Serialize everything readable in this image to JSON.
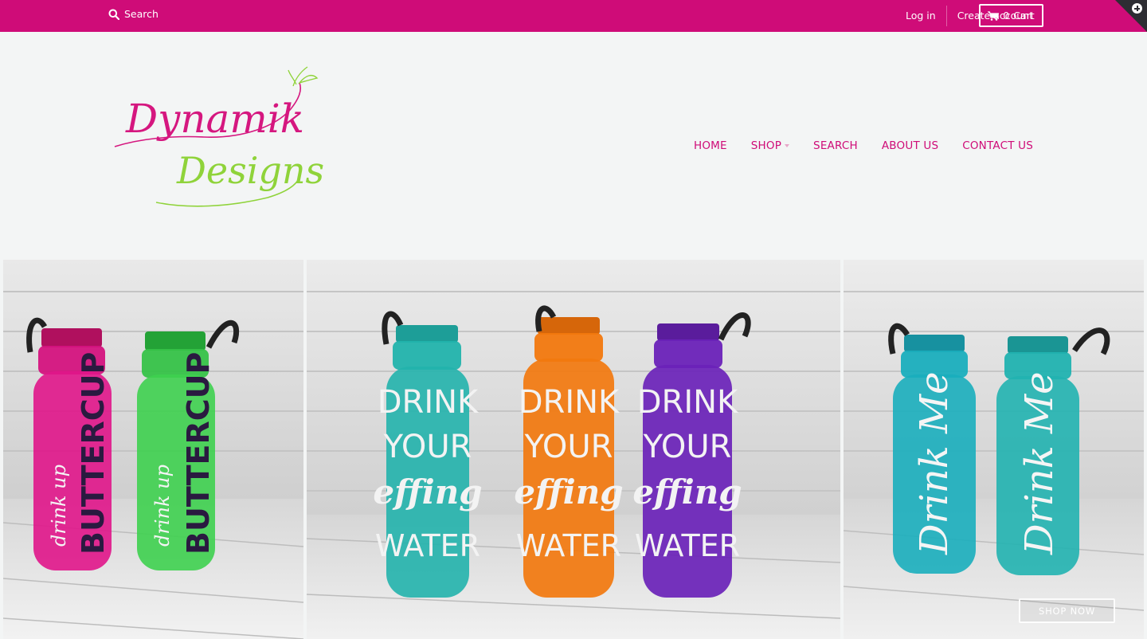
{
  "topbar": {
    "search_label": "Search",
    "login_label": "Log in",
    "create_account_label": "Create account",
    "cart_count": "0",
    "cart_label": "Cart",
    "accent_color": "#cf0c78"
  },
  "header": {
    "logo_line1": "Dynamik",
    "logo_line2": "Designs",
    "logo_colors": [
      "#d5177f",
      "#8fd33a"
    ]
  },
  "nav": {
    "items": [
      {
        "label": "HOME"
      },
      {
        "label": "SHOP",
        "has_dropdown": true
      },
      {
        "label": "SEARCH"
      },
      {
        "label": "ABOUT US"
      },
      {
        "label": "CONTACT US"
      }
    ]
  },
  "slider": {
    "panels": [
      {
        "bottles": [
          {
            "color": "#e0158a",
            "words": [
              "drink up",
              "BUTTERCUP"
            ]
          },
          {
            "color": "#3ed04f",
            "words": [
              "drink up",
              "BUTTERCUP"
            ]
          }
        ]
      },
      {
        "bottles": [
          {
            "color": "#22b3ac",
            "words": [
              "DRINK",
              "YOUR",
              "effing",
              "WATER"
            ]
          },
          {
            "color": "#f2780e",
            "words": [
              "DRINK",
              "YOUR",
              "effing",
              "WATER"
            ]
          },
          {
            "color": "#6a22b8",
            "words": [
              "DRINK",
              "YOUR",
              "effing",
              "WATER"
            ]
          }
        ]
      },
      {
        "bottles": [
          {
            "color": "#1aaebd",
            "words": [
              "Drink Me"
            ]
          },
          {
            "color": "#21b2b0",
            "words": [
              "Drink Me"
            ]
          }
        ]
      }
    ],
    "cta_label": "SHOP NOW"
  }
}
